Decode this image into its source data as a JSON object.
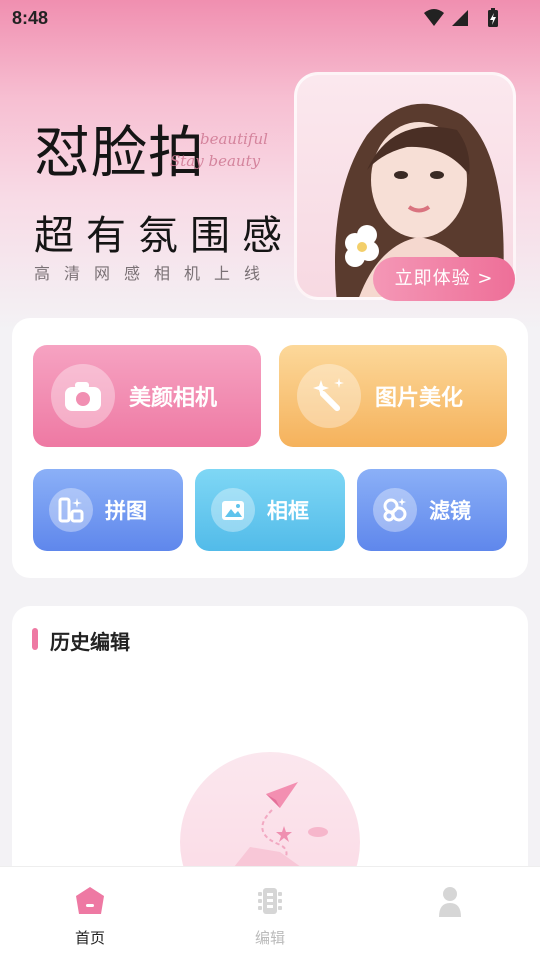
{
  "status_bar": {
    "time": "8:48"
  },
  "banner": {
    "title": "怼脸拍",
    "script_line1": "beautiful",
    "script_line2": "Stay beauty",
    "subtitle": "超有氛围感",
    "tagline": "高清网感相机上线",
    "cta_label": "立即体验 >"
  },
  "tools": {
    "camera": "美颜相机",
    "beautify": "图片美化",
    "collage": "拼图",
    "frame": "相框",
    "filter": "滤镜"
  },
  "history": {
    "title": "历史编辑"
  },
  "nav": {
    "home": "首页",
    "edit": "编辑",
    "mine": ""
  },
  "colors": {
    "accent_pink": "#ee79a3",
    "orange": "#f5b25c",
    "blue": "#5f87ec",
    "cyan": "#52bbe9"
  }
}
